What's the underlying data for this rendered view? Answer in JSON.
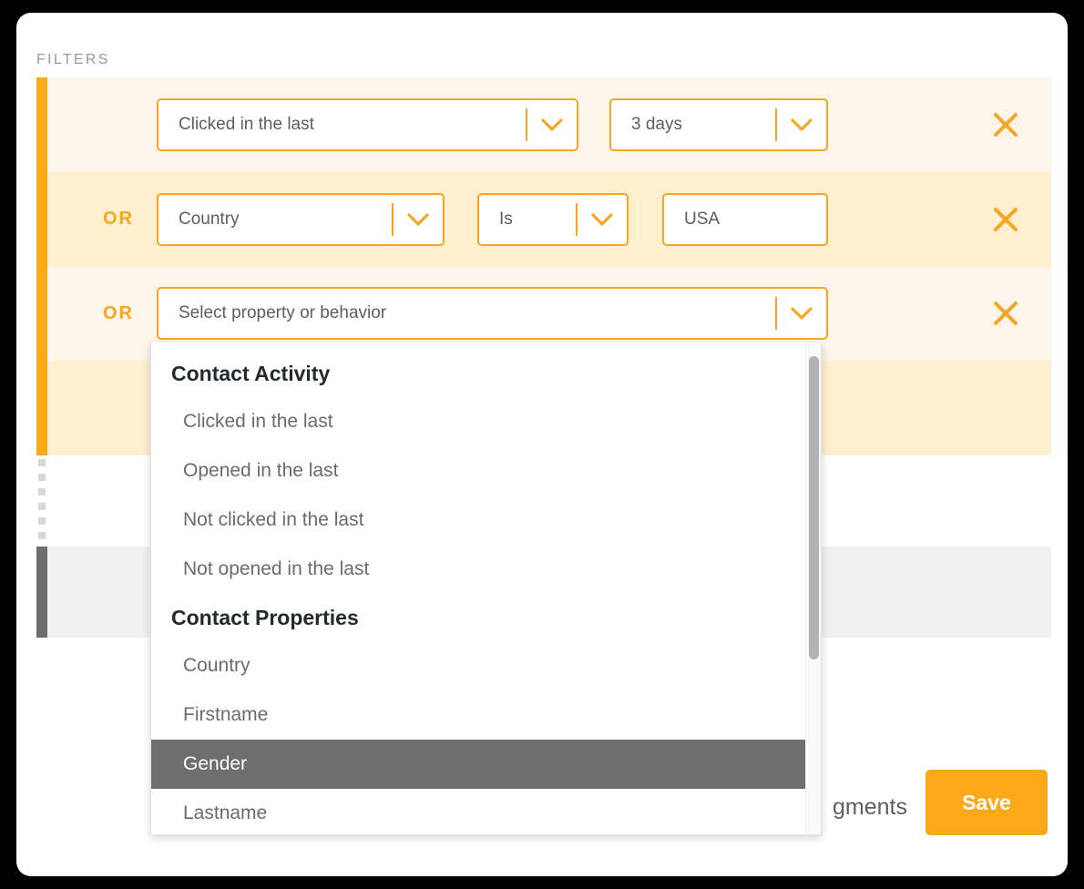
{
  "panel": {
    "section_label": "FILTERS"
  },
  "theme": {
    "accent": "#FBA919",
    "border_accent": "#F6A623",
    "row_light": "#FDF5E9",
    "row_dark": "#FEEFCF",
    "group_gray": "#6E6E6E",
    "group_gray_bg": "#F1F1F1",
    "text_gray": "#5e5e5e",
    "label_gray": "#9a9a9a"
  },
  "filter_rows": [
    {
      "connector": "",
      "controls": [
        {
          "type": "select",
          "value": "Clicked in the last"
        },
        {
          "type": "select",
          "value": "3 days"
        }
      ],
      "remove_label": "×"
    },
    {
      "connector": "OR",
      "controls": [
        {
          "type": "select",
          "value": "Country"
        },
        {
          "type": "select",
          "value": "Is"
        },
        {
          "type": "text",
          "value": "USA"
        }
      ],
      "remove_label": "×"
    },
    {
      "connector": "OR",
      "controls": [
        {
          "type": "select",
          "value": "Select property or behavior"
        }
      ],
      "remove_label": "×"
    },
    {
      "connector": "",
      "controls": [],
      "remove_label": ""
    }
  ],
  "dropdown": {
    "open": true,
    "groups": [
      {
        "title": "Contact Activity",
        "items": [
          {
            "label": "Clicked in the last",
            "selected": false
          },
          {
            "label": "Opened in the last",
            "selected": false
          },
          {
            "label": "Not clicked in the last",
            "selected": false
          },
          {
            "label": "Not opened in the last",
            "selected": false
          }
        ]
      },
      {
        "title": "Contact Properties",
        "items": [
          {
            "label": "Country",
            "selected": false
          },
          {
            "label": "Firstname",
            "selected": false
          },
          {
            "label": "Gender",
            "selected": true
          },
          {
            "label": "Lastname",
            "selected": false
          }
        ]
      }
    ]
  },
  "footer": {
    "occluded_text": "gments",
    "save_label": "Save"
  }
}
